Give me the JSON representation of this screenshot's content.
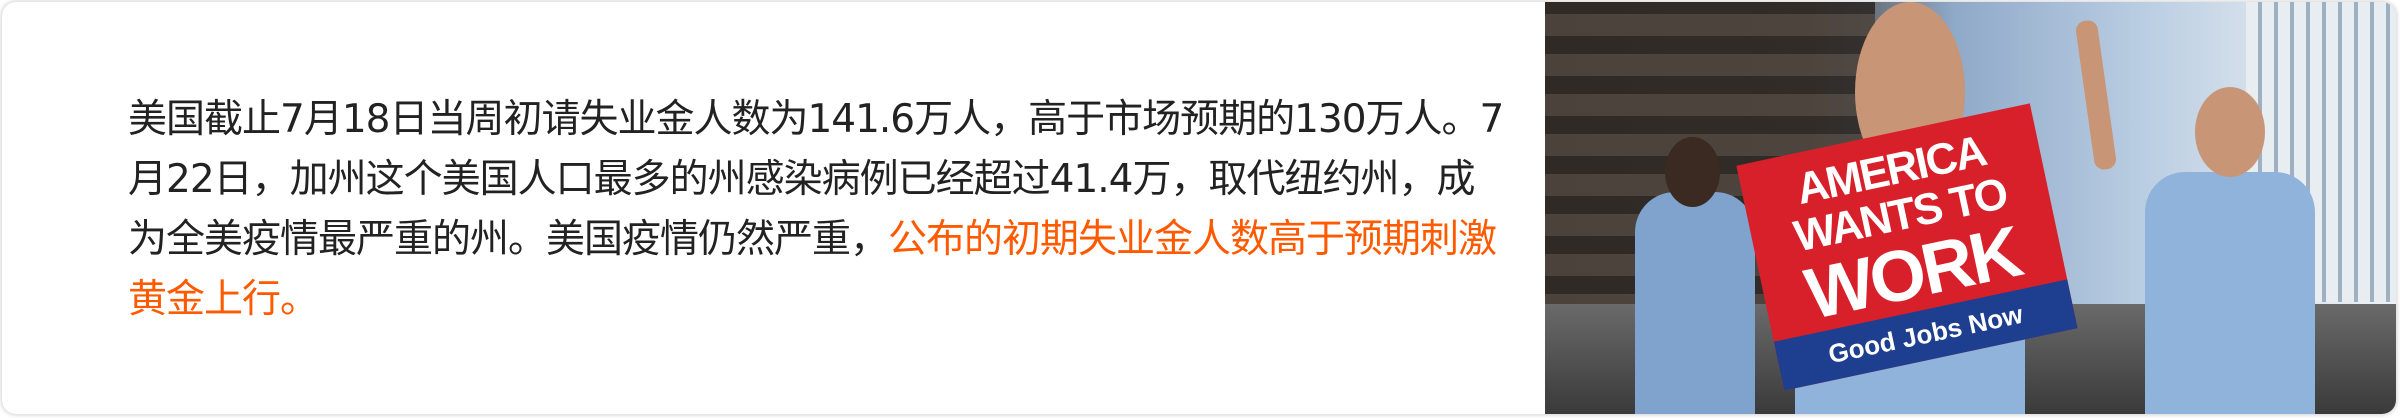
{
  "article": {
    "text_normal": "美国截止7月18日当周初请失业金人数为141.6万人，高于市场预期的130万人。7月22日，加州这个美国人口最多的州感染病例已经超过41.4万，取代纽约州，成为全美疫情最严重的州。美国疫情仍然严重，",
    "text_highlight": "公布的初期失业金人数高于预期刺激黄金上行。",
    "highlight_color": "#ff5a00"
  },
  "photo": {
    "sign_line1": "AMERICA",
    "sign_line2": "WANTS TO",
    "sign_line3": "WORK",
    "sign_footer": "Good Jobs Now"
  }
}
